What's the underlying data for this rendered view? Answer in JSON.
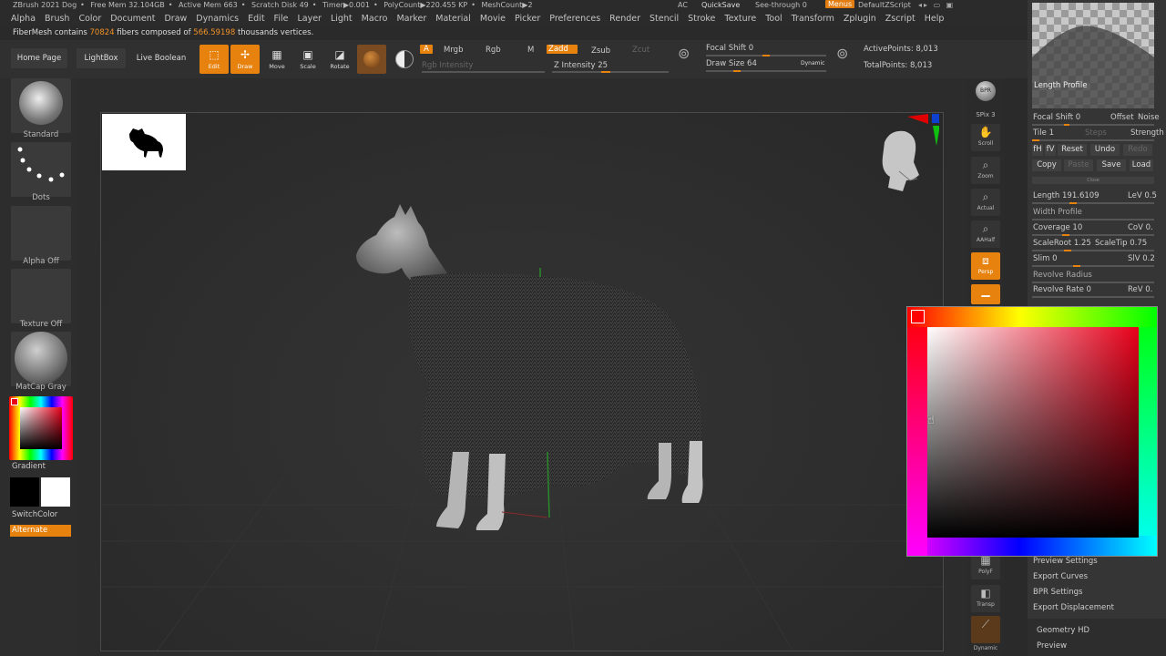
{
  "titlebar": {
    "app": "ZBrush 2021 Dog",
    "free_mem": "Free Mem 32.104GB",
    "active_mem": "Active Mem 663",
    "scratch": "Scratch Disk 49",
    "timer": "Timer▶0.001",
    "polycount": "PolyCount▶220.455 KP",
    "meshcount": "MeshCount▶2",
    "ac": "AC",
    "quicksave": "QuickSave",
    "seethrough": "See-through  0",
    "menus": "Menus",
    "script": "DefaultZScript"
  },
  "menu": [
    "Alpha",
    "Brush",
    "Color",
    "Document",
    "Draw",
    "Dynamics",
    "Edit",
    "File",
    "Layer",
    "Light",
    "Macro",
    "Marker",
    "Material",
    "Movie",
    "Picker",
    "Preferences",
    "Render",
    "Stencil",
    "Stroke",
    "Texture",
    "Tool",
    "Transform",
    "Zplugin",
    "Zscript",
    "Help"
  ],
  "info": {
    "prefix": "FiberMesh contains",
    "fibers": "70824",
    "mid": "fibers composed of",
    "vertices": "566.59198",
    "suffix": "thousands vertices."
  },
  "toolbar": {
    "home": "Home Page",
    "lightbox": "LightBox",
    "livebool": "Live Boolean",
    "edit": "Edit",
    "draw": "Draw",
    "move": "Move",
    "scale": "Scale",
    "rotate": "Rotate",
    "a": "A",
    "mrgb": "Mrgb",
    "rgb": "Rgb",
    "m": "M",
    "zadd": "Zadd",
    "zsub": "Zsub",
    "zcut": "Zcut",
    "rgb_intensity": "Rgb Intensity",
    "z_intensity": "Z Intensity 25",
    "focal_shift": "Focal Shift 0",
    "draw_size": "Draw Size 64",
    "dynamic": "Dynamic",
    "active_points": "ActivePoints: 8,013",
    "total_points": "TotalPoints: 8,013"
  },
  "left": {
    "standard": "Standard",
    "dots": "Dots",
    "alpha_off": "Alpha Off",
    "texture_off": "Texture Off",
    "matcap": "MatCap Gray",
    "gradient": "Gradient",
    "switchcolor": "SwitchColor",
    "alternate": "Alternate"
  },
  "rightshelf": [
    "BPR",
    "SPix 3",
    "Scroll",
    "Zoom",
    "Actual",
    "AAHalf",
    "Persp",
    "Floor",
    "PolyF",
    "Transp",
    "Dynamic"
  ],
  "tray": {
    "length_profile": "Length Profile",
    "focal_shift": "Focal Shift 0",
    "offset": "Offset",
    "noise": "Noise",
    "tile": "Tile 1",
    "steps": "Steps",
    "strength": "Strength",
    "fh": "fH",
    "fv": "fV",
    "reset": "Reset",
    "undo": "Undo",
    "redo": "Redo",
    "copy": "Copy",
    "paste": "Paste",
    "save": "Save",
    "load": "Load",
    "close": "Close",
    "length": "Length 191.6109",
    "lev": "LeV 0.5",
    "width_profile": "Width Profile",
    "coverage": "Coverage 10",
    "cov": "CoV 0.",
    "scaleroot": "ScaleRoot 1.25",
    "scaletip": "ScaleTip 0.75",
    "slim": "Slim 0",
    "siv": "SlV 0.2",
    "revolve_radius": "Revolve Radius",
    "revolve_rate": "Revolve Rate 0",
    "rev": "ReV 0.",
    "preview_settings": "Preview Settings",
    "export_curves": "Export Curves",
    "bpr_settings": "BPR Settings",
    "export_disp": "Export Displacement",
    "geometry_hd": "Geometry HD",
    "preview": "Preview"
  },
  "colors": {
    "accent": "#e7820e",
    "picker_selected": "#e8001a"
  }
}
